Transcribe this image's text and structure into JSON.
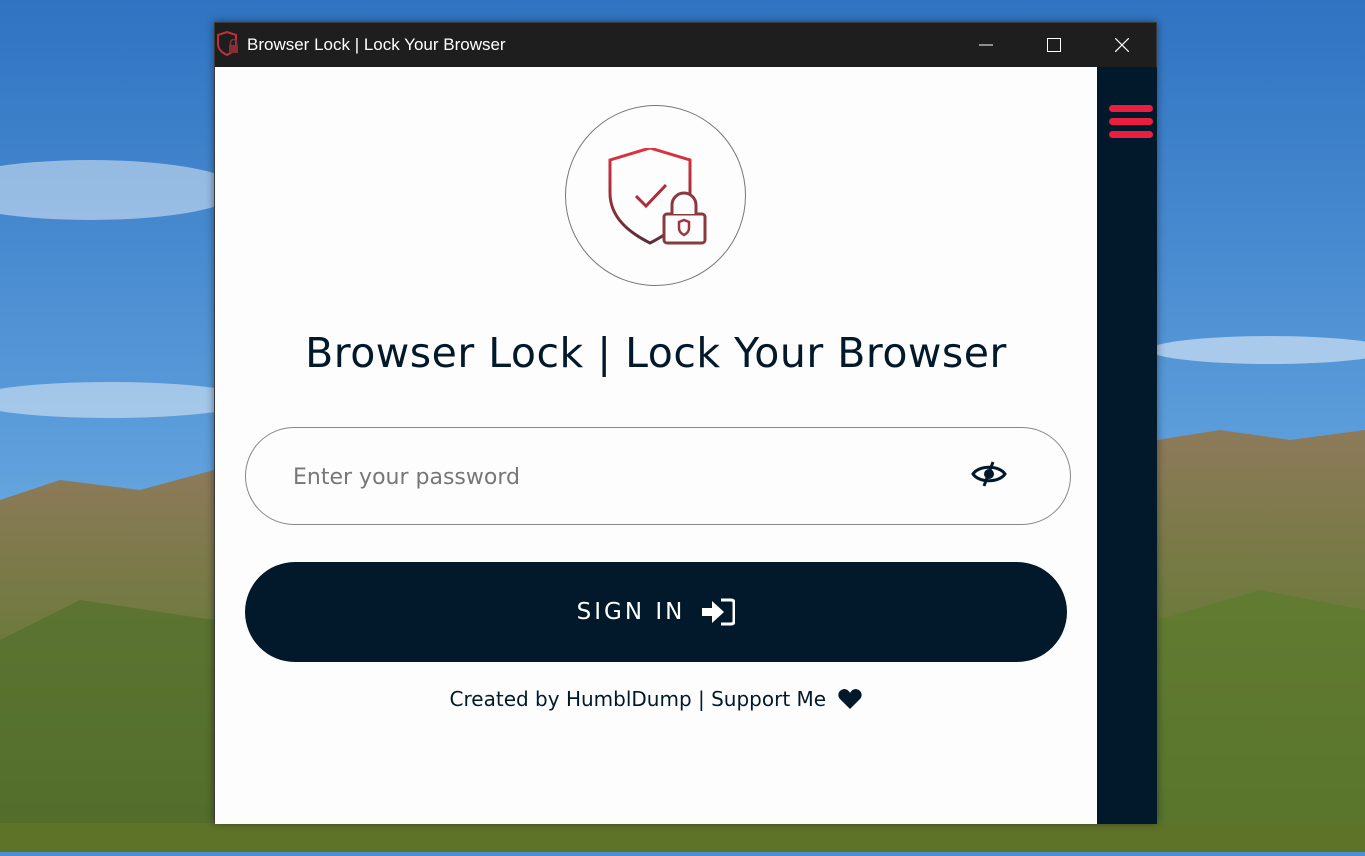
{
  "window": {
    "title": "Browser Lock | Lock Your Browser"
  },
  "app": {
    "heading": "Browser Lock | Lock Your Browser",
    "password": {
      "value": "",
      "placeholder": "Enter your password"
    },
    "signin_label": "SIGN IN",
    "footer": {
      "prefix": "Created by ",
      "author_link": "HumblDump",
      "separator": " | ",
      "support_link": "Support Me"
    }
  },
  "icons": {
    "app": "shield-lock-icon",
    "minimize": "minimize-icon",
    "maximize": "maximize-icon",
    "close": "close-icon",
    "menu": "hamburger-menu-icon",
    "toggle_password": "eye-slash-icon",
    "signin": "sign-in-icon",
    "heart": "heart-icon"
  },
  "colors": {
    "brand_dark": "#02192b",
    "accent_red": "#ea1f3f",
    "titlebar": "#1e1e1e"
  }
}
